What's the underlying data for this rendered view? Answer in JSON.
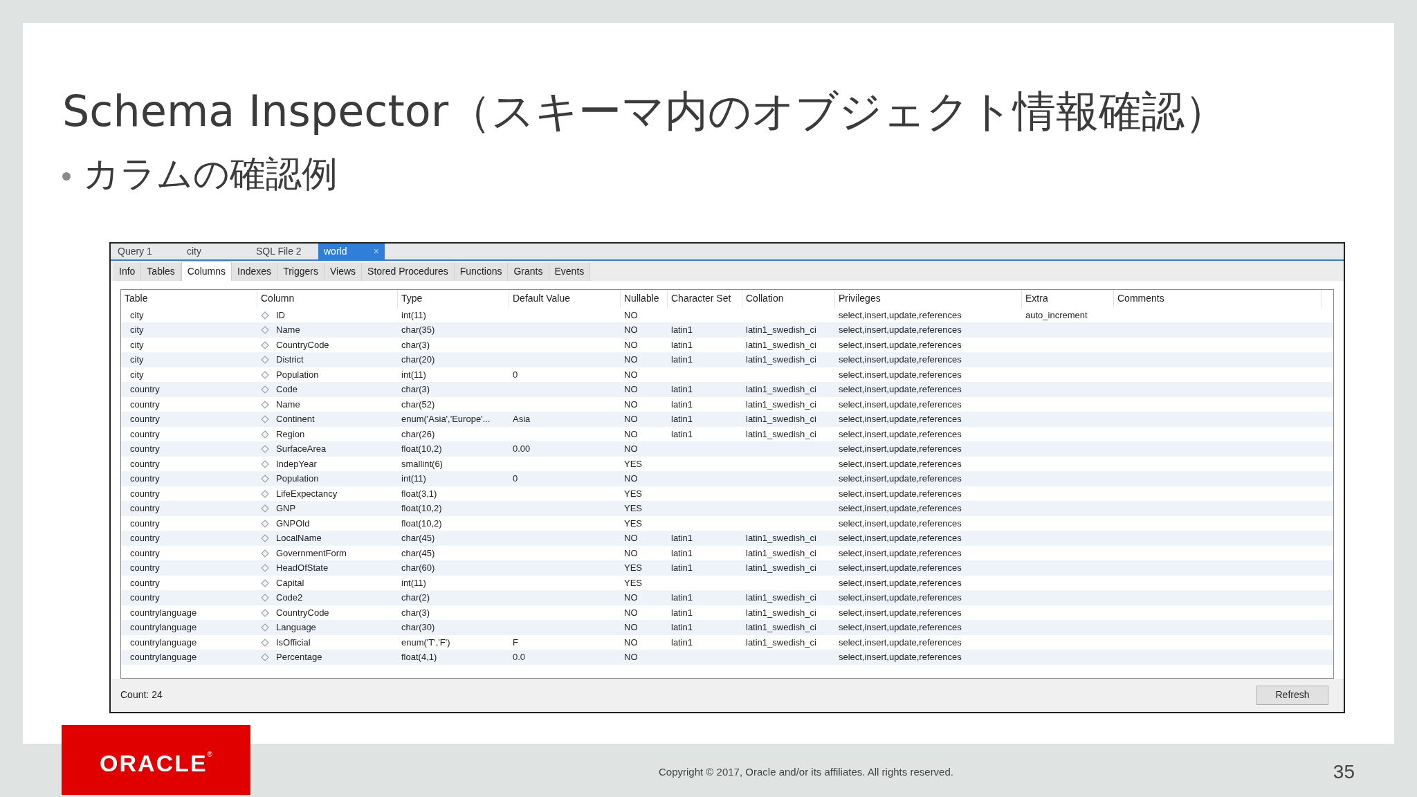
{
  "slide": {
    "title": "Schema Inspector（スキーマ内のオブジェクト情報確認）",
    "bullet": "カラムの確認例",
    "page_number": "35",
    "copyright": "Copyright © 2017, Oracle and/or its affiliates. All rights reserved.",
    "logo": {
      "text": "ORACLE",
      "mark": "®"
    }
  },
  "editor_tabs": [
    {
      "label": "Query 1",
      "selected": false
    },
    {
      "label": "city",
      "selected": false
    },
    {
      "label": "SQL File 2",
      "selected": false
    },
    {
      "label": "world",
      "selected": true,
      "close": "×"
    }
  ],
  "inspector_tabs": [
    {
      "label": "Info",
      "selected": false
    },
    {
      "label": "Tables",
      "selected": false
    },
    {
      "label": "Columns",
      "selected": true
    },
    {
      "label": "Indexes",
      "selected": false
    },
    {
      "label": "Triggers",
      "selected": false
    },
    {
      "label": "Views",
      "selected": false
    },
    {
      "label": "Stored Procedures",
      "selected": false
    },
    {
      "label": "Functions",
      "selected": false
    },
    {
      "label": "Grants",
      "selected": false
    },
    {
      "label": "Events",
      "selected": false
    }
  ],
  "table": {
    "columns": [
      "Table",
      "Column",
      "Type",
      "Default Value",
      "Nullable",
      "Character Set",
      "Collation",
      "Privileges",
      "Extra",
      "Comments"
    ],
    "rows": [
      {
        "table": "city",
        "column": "ID",
        "type": "int(11)",
        "nullable": "NO",
        "privileges": "select,insert,update,references",
        "extra": "auto_increment"
      },
      {
        "table": "city",
        "column": "Name",
        "type": "char(35)",
        "nullable": "NO",
        "charset": "latin1",
        "collation": "latin1_swedish_ci",
        "privileges": "select,insert,update,references"
      },
      {
        "table": "city",
        "column": "CountryCode",
        "type": "char(3)",
        "nullable": "NO",
        "charset": "latin1",
        "collation": "latin1_swedish_ci",
        "privileges": "select,insert,update,references"
      },
      {
        "table": "city",
        "column": "District",
        "type": "char(20)",
        "nullable": "NO",
        "charset": "latin1",
        "collation": "latin1_swedish_ci",
        "privileges": "select,insert,update,references"
      },
      {
        "table": "city",
        "column": "Population",
        "type": "int(11)",
        "default": "0",
        "nullable": "NO",
        "privileges": "select,insert,update,references"
      },
      {
        "table": "country",
        "column": "Code",
        "type": "char(3)",
        "nullable": "NO",
        "charset": "latin1",
        "collation": "latin1_swedish_ci",
        "privileges": "select,insert,update,references"
      },
      {
        "table": "country",
        "column": "Name",
        "type": "char(52)",
        "nullable": "NO",
        "charset": "latin1",
        "collation": "latin1_swedish_ci",
        "privileges": "select,insert,update,references"
      },
      {
        "table": "country",
        "column": "Continent",
        "type": "enum('Asia','Europe'...",
        "default": "Asia",
        "nullable": "NO",
        "charset": "latin1",
        "collation": "latin1_swedish_ci",
        "privileges": "select,insert,update,references"
      },
      {
        "table": "country",
        "column": "Region",
        "type": "char(26)",
        "nullable": "NO",
        "charset": "latin1",
        "collation": "latin1_swedish_ci",
        "privileges": "select,insert,update,references"
      },
      {
        "table": "country",
        "column": "SurfaceArea",
        "type": "float(10,2)",
        "default": "0.00",
        "nullable": "NO",
        "privileges": "select,insert,update,references"
      },
      {
        "table": "country",
        "column": "IndepYear",
        "type": "smallint(6)",
        "nullable": "YES",
        "privileges": "select,insert,update,references"
      },
      {
        "table": "country",
        "column": "Population",
        "type": "int(11)",
        "default": "0",
        "nullable": "NO",
        "privileges": "select,insert,update,references"
      },
      {
        "table": "country",
        "column": "LifeExpectancy",
        "type": "float(3,1)",
        "nullable": "YES",
        "privileges": "select,insert,update,references"
      },
      {
        "table": "country",
        "column": "GNP",
        "type": "float(10,2)",
        "nullable": "YES",
        "privileges": "select,insert,update,references"
      },
      {
        "table": "country",
        "column": "GNPOld",
        "type": "float(10,2)",
        "nullable": "YES",
        "privileges": "select,insert,update,references"
      },
      {
        "table": "country",
        "column": "LocalName",
        "type": "char(45)",
        "nullable": "NO",
        "charset": "latin1",
        "collation": "latin1_swedish_ci",
        "privileges": "select,insert,update,references"
      },
      {
        "table": "country",
        "column": "GovernmentForm",
        "type": "char(45)",
        "nullable": "NO",
        "charset": "latin1",
        "collation": "latin1_swedish_ci",
        "privileges": "select,insert,update,references"
      },
      {
        "table": "country",
        "column": "HeadOfState",
        "type": "char(60)",
        "nullable": "YES",
        "charset": "latin1",
        "collation": "latin1_swedish_ci",
        "privileges": "select,insert,update,references"
      },
      {
        "table": "country",
        "column": "Capital",
        "type": "int(11)",
        "nullable": "YES",
        "privileges": "select,insert,update,references"
      },
      {
        "table": "country",
        "column": "Code2",
        "type": "char(2)",
        "nullable": "NO",
        "charset": "latin1",
        "collation": "latin1_swedish_ci",
        "privileges": "select,insert,update,references"
      },
      {
        "table": "countrylanguage",
        "column": "CountryCode",
        "type": "char(3)",
        "nullable": "NO",
        "charset": "latin1",
        "collation": "latin1_swedish_ci",
        "privileges": "select,insert,update,references"
      },
      {
        "table": "countrylanguage",
        "column": "Language",
        "type": "char(30)",
        "nullable": "NO",
        "charset": "latin1",
        "collation": "latin1_swedish_ci",
        "privileges": "select,insert,update,references"
      },
      {
        "table": "countrylanguage",
        "column": "IsOfficial",
        "type": "enum('T','F')",
        "default": "F",
        "nullable": "NO",
        "charset": "latin1",
        "collation": "latin1_swedish_ci",
        "privileges": "select,insert,update,references"
      },
      {
        "table": "countrylanguage",
        "column": "Percentage",
        "type": "float(4,1)",
        "default": "0.0",
        "nullable": "NO",
        "privileges": "select,insert,update,references"
      }
    ]
  },
  "status": {
    "count": "Count: 24",
    "refresh_button": "Refresh"
  }
}
